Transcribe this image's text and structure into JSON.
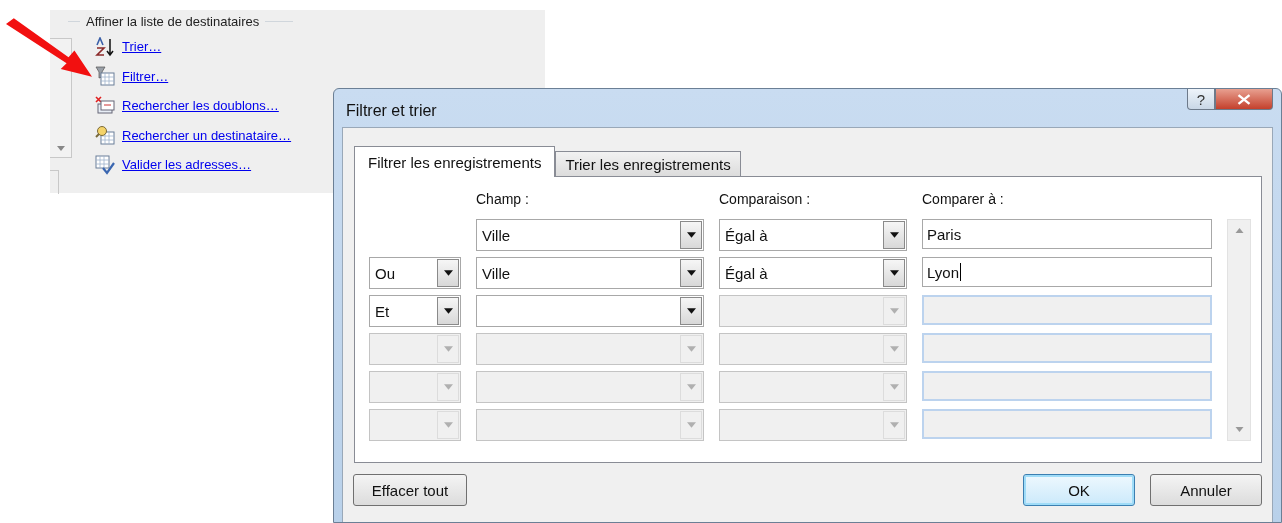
{
  "panel": {
    "title": "Affiner la liste de destinataires",
    "links": [
      {
        "label": "Trier…",
        "kind": "sort"
      },
      {
        "label": "Filtrer…",
        "kind": "filter"
      },
      {
        "label": "Rechercher les doublons…",
        "kind": "duplicates"
      },
      {
        "label": "Rechercher un destinataire…",
        "kind": "find"
      },
      {
        "label": "Valider les adresses…",
        "kind": "validate"
      }
    ]
  },
  "dialog": {
    "title": "Filtrer et trier",
    "help_button": "?",
    "tabs": [
      {
        "label": "Filtrer les enregistrements",
        "selected": true
      },
      {
        "label": "Trier les enregistrements",
        "selected": false
      }
    ],
    "columns": [
      "Champ :",
      "Comparaison :",
      "Comparer à :"
    ],
    "rows": [
      {
        "field": {
          "value": "Ville",
          "disabled": false
        },
        "comparison": {
          "value": "Égal à",
          "disabled": false
        },
        "compare_to": {
          "value": "Paris",
          "disabled": false,
          "focused": false
        }
      },
      {
        "conjunction": {
          "value": "Ou",
          "disabled": false
        },
        "field": {
          "value": "Ville",
          "disabled": false
        },
        "comparison": {
          "value": "Égal à",
          "disabled": false
        },
        "compare_to": {
          "value": "Lyon",
          "disabled": false,
          "focused": true
        }
      },
      {
        "conjunction": {
          "value": "Et",
          "disabled": false
        },
        "field": {
          "disabled": false
        },
        "comparison": {
          "disabled": true
        },
        "compare_to": {
          "disabled": true,
          "focused": false
        }
      },
      {
        "conjunction": {
          "disabled": true
        },
        "field": {
          "disabled": true
        },
        "comparison": {
          "disabled": true
        },
        "compare_to": {
          "disabled": true,
          "focused": false
        }
      },
      {
        "conjunction": {
          "disabled": true
        },
        "field": {
          "disabled": true
        },
        "comparison": {
          "disabled": true
        },
        "compare_to": {
          "disabled": true,
          "focused": false
        }
      },
      {
        "conjunction": {
          "disabled": true
        },
        "field": {
          "disabled": true
        },
        "comparison": {
          "disabled": true
        },
        "compare_to": {
          "disabled": true,
          "focused": false
        }
      }
    ],
    "buttons": [
      {
        "label": "Effacer tout",
        "kind": "clear",
        "default": false
      },
      {
        "label": "OK",
        "kind": "ok",
        "default": true
      },
      {
        "label": "Annuler",
        "kind": "cancel",
        "default": false
      }
    ]
  }
}
